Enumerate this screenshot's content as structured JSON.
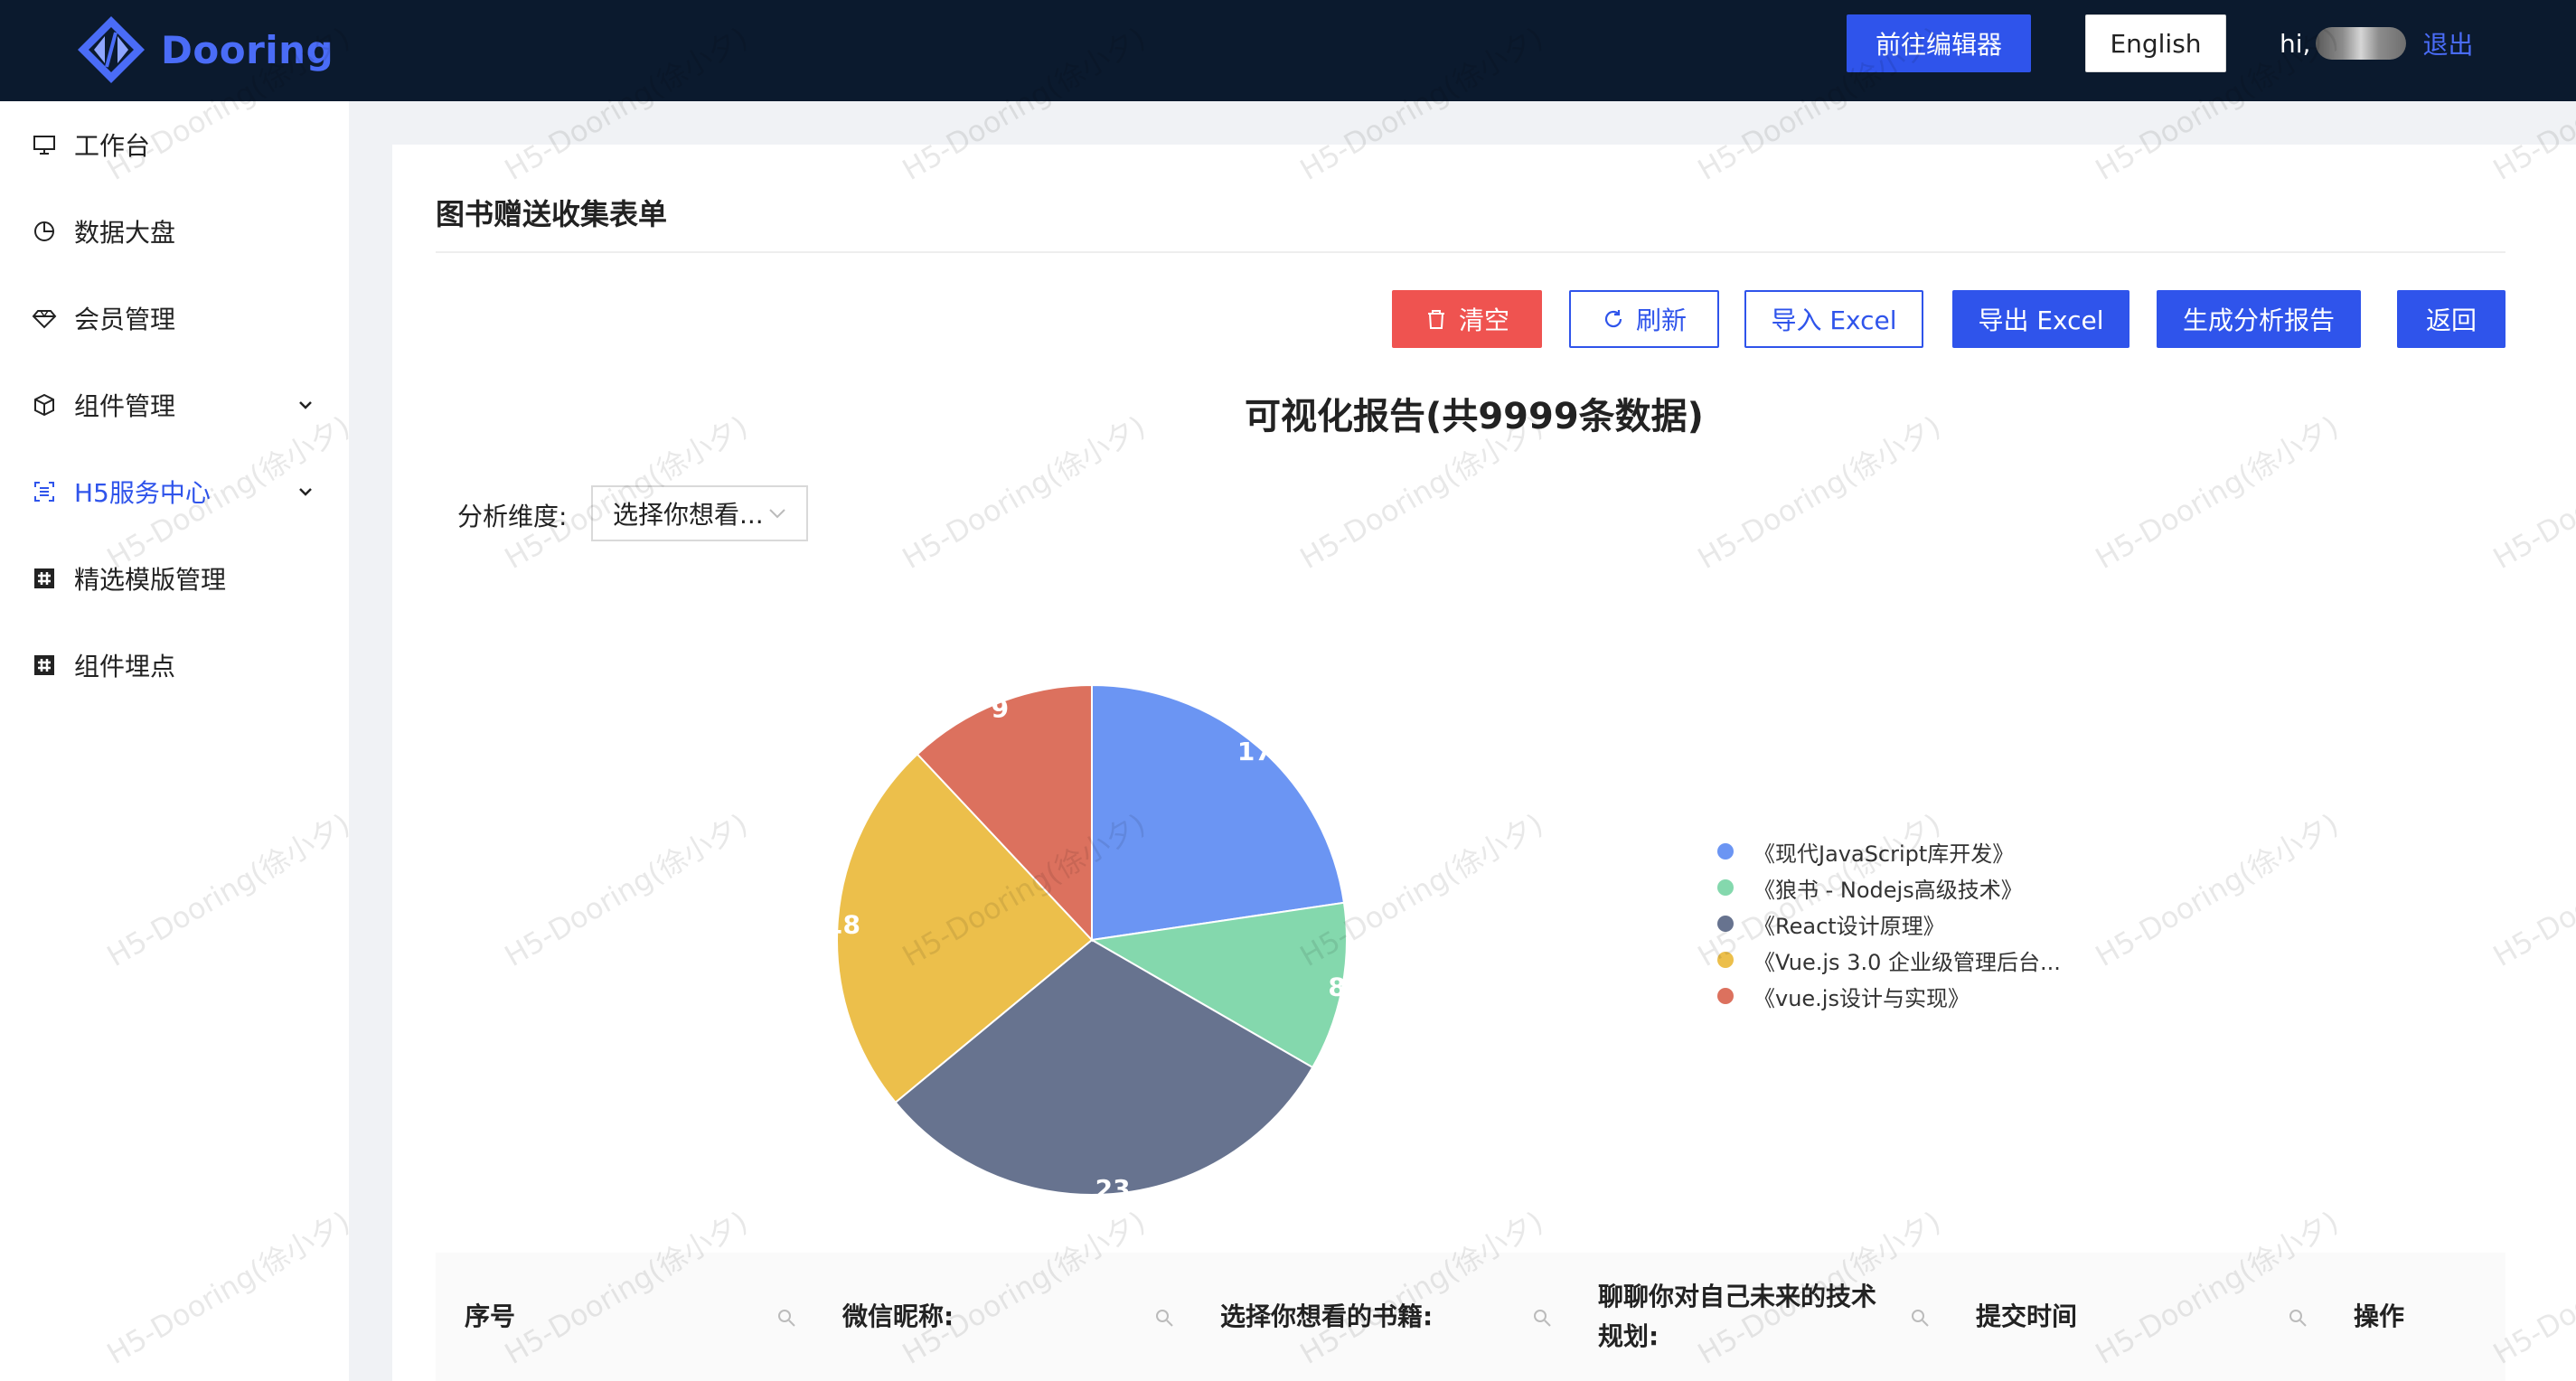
{
  "header": {
    "logo_text": "Dooring",
    "editor_button": "前往编辑器",
    "lang_button": "English",
    "greeting": "hi,",
    "logout": "退出"
  },
  "sidebar": {
    "items": [
      {
        "label": "工作台",
        "icon": "monitor-icon",
        "expandable": false,
        "active": false
      },
      {
        "label": "数据大盘",
        "icon": "pie-chart-icon",
        "expandable": false,
        "active": false
      },
      {
        "label": "会员管理",
        "icon": "diamond-icon",
        "expandable": false,
        "active": false
      },
      {
        "label": "组件管理",
        "icon": "cube-icon",
        "expandable": true,
        "active": false
      },
      {
        "label": "H5服务中心",
        "icon": "scan-icon",
        "expandable": true,
        "active": true
      },
      {
        "label": "精选模版管理",
        "icon": "slack-icon",
        "expandable": false,
        "active": false
      },
      {
        "label": "组件埋点",
        "icon": "slack-icon",
        "expandable": false,
        "active": false
      }
    ]
  },
  "main": {
    "page_title": "图书赠送收集表单",
    "actions": {
      "clear": "清空",
      "refresh": "刷新",
      "import": "导入 Excel",
      "export": "导出 Excel",
      "report": "生成分析报告",
      "back": "返回"
    },
    "report_title": "可视化报告(共9999条数据)",
    "dimension": {
      "label": "分析维度:",
      "selected": "选择你想看..."
    },
    "table": {
      "columns": [
        "序号",
        "微信昵称:",
        "选择你想看的书籍:",
        "聊聊你对自己未来的技术\n规划:",
        "提交时间",
        "操作"
      ]
    }
  },
  "chart_data": {
    "type": "pie",
    "categories": [
      "《现代JavaScript库开发》",
      "《狼书 - Nodejs高级技术》",
      "《React设计原理》",
      "《Vue.js 3.0 企业级管理后台...",
      "《vue.js设计与实现》"
    ],
    "values": [
      17,
      8,
      23,
      18,
      9
    ],
    "visible_labels": [
      "17",
      "8",
      "23",
      "18",
      "9"
    ],
    "legend_position": "right"
  },
  "colors": {
    "primary": "#2f54eb",
    "danger": "#ef5350",
    "header_bg": "#0b1a2e",
    "slices": [
      "#6b95f3",
      "#84d8ad",
      "#67738f",
      "#ecbf4b",
      "#dc715e"
    ]
  },
  "watermark": "H5-Dooring(徐小夕)"
}
